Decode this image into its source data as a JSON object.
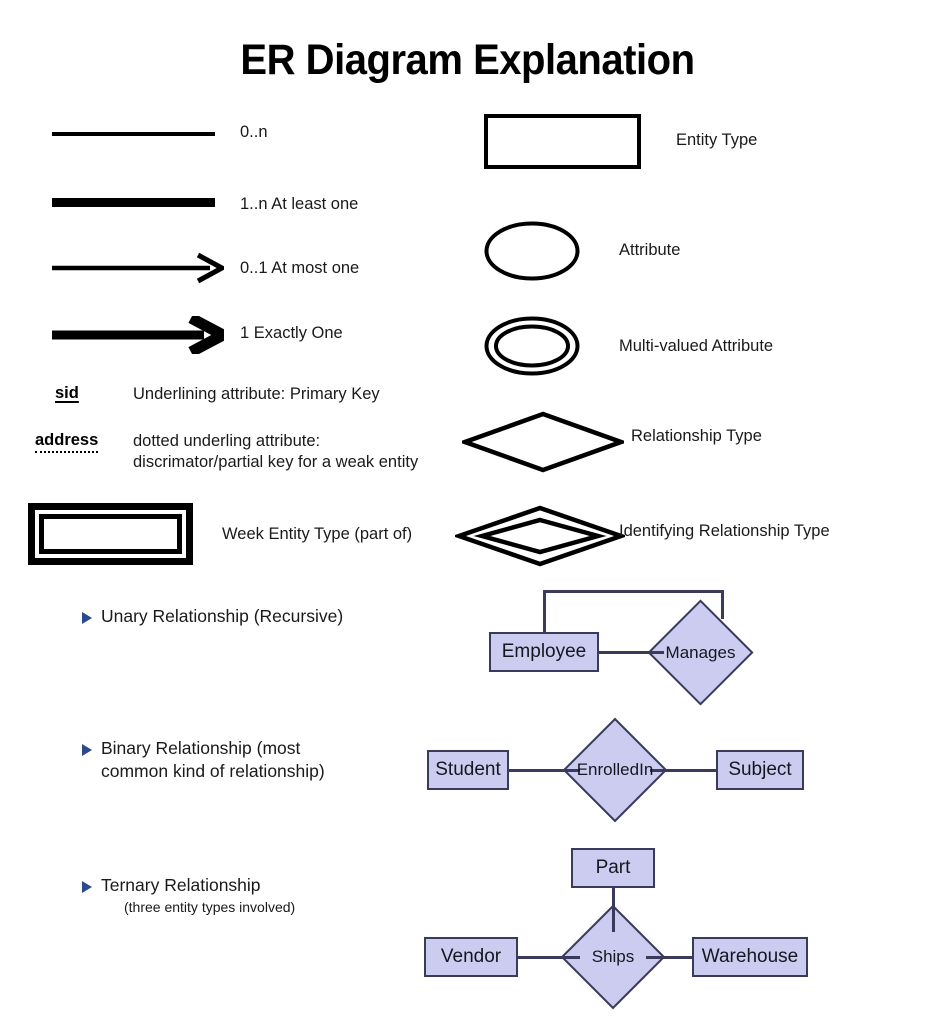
{
  "title": "ER Diagram Explanation",
  "cardinality_legend": [
    {
      "id": "zero-to-n",
      "symbol": "thin-line",
      "label": "0..n"
    },
    {
      "id": "one-to-n",
      "symbol": "thick-line",
      "label": "1..n At least one"
    },
    {
      "id": "zero-to-one",
      "symbol": "thin-arrow",
      "label": "0..1 At most one"
    },
    {
      "id": "exactly-one",
      "symbol": "thick-arrow",
      "label": "1 Exactly One"
    }
  ],
  "attribute_key": [
    {
      "term": "sid",
      "underline": "solid",
      "description": "Underlining attribute: Primary Key"
    },
    {
      "term": "address",
      "underline": "dotted",
      "description": "dotted underling attribute:\ndiscrimator/partial key for a weak entity"
    }
  ],
  "weak_entity": {
    "label": "Week Entity Type (part of)"
  },
  "shape_legend": [
    {
      "id": "entity-type",
      "shape": "rectangle",
      "label": "Entity Type"
    },
    {
      "id": "attribute",
      "shape": "ellipse",
      "label": "Attribute"
    },
    {
      "id": "multi-valued-attribute",
      "shape": "double-ellipse",
      "label": "Multi-valued Attribute"
    },
    {
      "id": "relationship-type",
      "shape": "diamond",
      "label": "Relationship Type"
    },
    {
      "id": "identifying-relationship-type",
      "shape": "double-diamond",
      "label": "Identifying Relationship Type"
    }
  ],
  "relationship_examples": [
    {
      "id": "unary",
      "bullet": "Unary Relationship (Recursive)",
      "sub_note": "",
      "entities": [
        "Employee"
      ],
      "relationship": "Manages"
    },
    {
      "id": "binary",
      "bullet": "Binary Relationship (most\ncommon kind of relationship)",
      "sub_note": "",
      "entities": [
        "Student",
        "Subject"
      ],
      "relationship": "EnrolledIn"
    },
    {
      "id": "ternary",
      "bullet": "Ternary Relationship",
      "sub_note": "(three entity types involved)",
      "entities": [
        "Part",
        "Vendor",
        "Warehouse"
      ],
      "relationship": "Ships"
    }
  ],
  "colors": {
    "shape_fill": "#ccccf0",
    "shape_border": "#3a3a5c",
    "bullet": "#2a4a8c",
    "ink": "#000000"
  }
}
